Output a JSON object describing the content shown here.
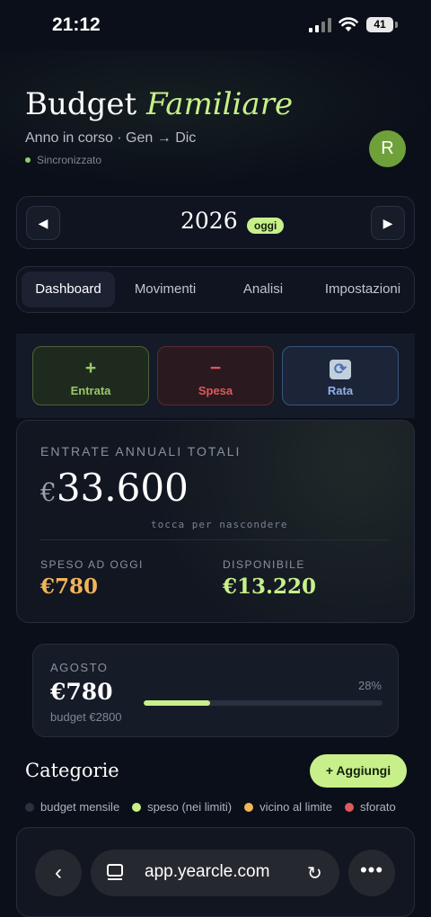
{
  "status_bar": {
    "time": "21:12",
    "battery": "41"
  },
  "header": {
    "title_main": "Budget",
    "title_accent": "Familiare",
    "subtitle": "Anno in corso · Gen → Dic",
    "sync_status": "Sincronizzato",
    "avatar_initial": "R"
  },
  "year_selector": {
    "prev_icon": "◀",
    "year": "2026",
    "badge": "oggi",
    "next_icon": "▶"
  },
  "tabs": [
    {
      "label": "Dashboard",
      "active": true
    },
    {
      "label": "Movimenti",
      "active": false
    },
    {
      "label": "Analisi",
      "active": false
    },
    {
      "label": "Impostazioni",
      "active": false
    }
  ],
  "actions": {
    "income": {
      "icon": "+",
      "label": "Entrata"
    },
    "expense": {
      "icon": "−",
      "label": "Spesa"
    },
    "installment": {
      "icon": "🔄",
      "label": "Rata"
    }
  },
  "totals": {
    "label": "ENTRATE ANNUALI TOTALI",
    "currency": "€",
    "amount": "33.600",
    "hint": "tocca per nascondere",
    "spent_label": "SPESO AD OGGI",
    "spent_value": "€780",
    "available_label": "DISPONIBILE",
    "available_value": "€13.220"
  },
  "month": {
    "name": "AGOSTO",
    "amount": "€780",
    "budget": "budget €2800",
    "percent_label": "28%",
    "progress": 0.28
  },
  "categories": {
    "title": "Categorie",
    "add_button": "+ Aggiungi",
    "legend": [
      {
        "label": "budget mensile",
        "color": "#2b3040"
      },
      {
        "label": "speso (nei limiti)",
        "color": "#c7f08a"
      },
      {
        "label": "vicino al limite",
        "color": "#f0b45a"
      },
      {
        "label": "sforato",
        "color": "#e0585b"
      }
    ]
  },
  "colors": {
    "accent": "#c7f08a",
    "spent": "#f0b45a",
    "available": "#c7f08a",
    "danger": "#e0585b",
    "info": "#8fb2ea"
  },
  "browser": {
    "url": "app.yearcle.com",
    "back_icon": "‹",
    "reload_icon": "↻",
    "more_icon": "•••"
  }
}
